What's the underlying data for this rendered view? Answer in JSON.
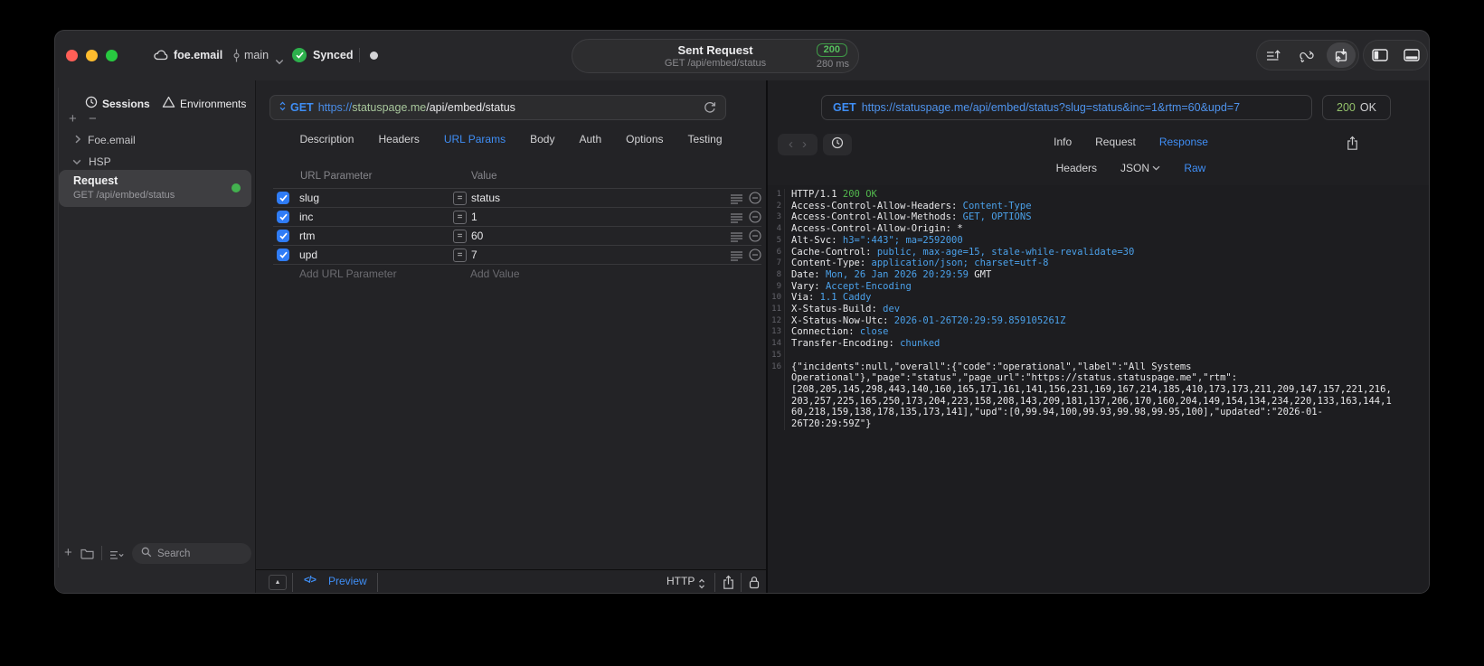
{
  "colors": {
    "accent_blue": "#3f8ef5",
    "value_blue": "#4ba1ea",
    "status_green": "#52b84d",
    "host_green": "#a8c79c",
    "checkbox_blue": "#2f7cf6",
    "traffic_red": "#ff5f57",
    "traffic_yellow": "#febc2e",
    "traffic_green": "#28c840"
  },
  "icons": {
    "titlebar": [
      "cloud-icon",
      "commit-icon",
      "chevron-down-icon",
      "synced-check-icon",
      "recording-dot"
    ],
    "toolbar": [
      "request-list-icon",
      "loop-icon",
      "send-receive-icon",
      "panel-left-icon",
      "panel-bottom-icon"
    ],
    "sidebar": [
      "clock-icon",
      "environments-triangle-icon",
      "plus-icon",
      "minus-icon",
      "chevron-right-icon",
      "chevron-down-icon",
      "folder-icon",
      "list-filter-icon",
      "search-icon"
    ],
    "request": [
      "method-updown-icon",
      "refresh-icon",
      "checkbox-check-icon",
      "equals-badge",
      "reorder-handle-icon",
      "remove-circle-icon",
      "expand-up-icon",
      "code-icon",
      "http-updown-icon",
      "share-icon",
      "lock-icon"
    ],
    "response": [
      "back-icon",
      "forward-icon",
      "history-clock-icon",
      "share-icon",
      "json-chevron-icon"
    ]
  },
  "titlebar": {
    "cloud_label": "foe.email",
    "branch": "main",
    "sync_status": "Synced",
    "sent_request": {
      "title": "Sent Request",
      "subtitle": "GET /api/embed/status",
      "status_code": "200",
      "duration": "280 ms"
    }
  },
  "sidebar": {
    "tabs": [
      {
        "label": "Sessions"
      },
      {
        "label": "Environments"
      }
    ],
    "tree": [
      {
        "label": "Foe.email",
        "state": "collapsed"
      },
      {
        "label": "HSP",
        "state": "expanded"
      }
    ],
    "request_item": {
      "title": "Request",
      "subtitle": "GET /api/embed/status"
    },
    "search_placeholder": "Search"
  },
  "request_panel": {
    "method": "GET",
    "url_scheme": "https://",
    "url_host": "statuspage.me",
    "url_path": "/api/embed/status",
    "tabs": [
      "Description",
      "Headers",
      "URL Params",
      "Body",
      "Auth",
      "Options",
      "Testing"
    ],
    "active_tab": "URL Params",
    "params_table": {
      "columns": [
        "URL Parameter",
        "Value"
      ],
      "eq_symbol": "=",
      "rows": [
        {
          "name": "slug",
          "value": "status",
          "enabled": true
        },
        {
          "name": "inc",
          "value": "1",
          "enabled": true
        },
        {
          "name": "rtm",
          "value": "60",
          "enabled": true
        },
        {
          "name": "upd",
          "value": "7",
          "enabled": true
        }
      ],
      "add_name_placeholder": "Add URL Parameter",
      "add_value_placeholder": "Add Value"
    },
    "footer": {
      "expand_glyph": "▲",
      "code_glyph": "</>",
      "preview_label": "Preview",
      "protocol_label": "HTTP"
    }
  },
  "response_panel": {
    "method": "GET",
    "url": "https://statuspage.me/api/embed/status?slug=status&inc=1&rtm=60&upd=7",
    "status": {
      "code": "200",
      "text": "OK"
    },
    "nav": {
      "back": "‹",
      "forward": "›"
    },
    "tabs": [
      "Info",
      "Request",
      "Response"
    ],
    "active_tab": "Response",
    "subtabs": [
      {
        "label": "Headers"
      },
      {
        "label": "JSON",
        "dropdown": true
      },
      {
        "label": "Raw"
      }
    ],
    "active_subtab": "Raw",
    "code_lines": [
      {
        "n": "1",
        "segs": [
          [
            "HTTP/1.1 ",
            "p"
          ],
          [
            "200 OK",
            "g"
          ]
        ]
      },
      {
        "n": "2",
        "segs": [
          [
            "Access-Control-Allow-Headers: ",
            "p"
          ],
          [
            "Content-Type",
            "b"
          ]
        ]
      },
      {
        "n": "3",
        "segs": [
          [
            "Access-Control-Allow-Methods: ",
            "p"
          ],
          [
            "GET, OPTIONS",
            "b"
          ]
        ]
      },
      {
        "n": "4",
        "segs": [
          [
            "Access-Control-Allow-Origin: *",
            "p"
          ]
        ]
      },
      {
        "n": "5",
        "segs": [
          [
            "Alt-Svc: ",
            "p"
          ],
          [
            "h3=\":443\"; ma=2592000",
            "b"
          ]
        ]
      },
      {
        "n": "6",
        "segs": [
          [
            "Cache-Control: ",
            "p"
          ],
          [
            "public, max-age=15, stale-while-revalidate=30",
            "b"
          ]
        ]
      },
      {
        "n": "7",
        "segs": [
          [
            "Content-Type: ",
            "p"
          ],
          [
            "application/json; charset=utf-8",
            "b"
          ]
        ]
      },
      {
        "n": "8",
        "segs": [
          [
            "Date: ",
            "p"
          ],
          [
            "Mon, 26 Jan 2026 20:29:59",
            "b"
          ],
          [
            " GMT",
            "p"
          ]
        ]
      },
      {
        "n": "9",
        "segs": [
          [
            "Vary: ",
            "p"
          ],
          [
            "Accept-Encoding",
            "b"
          ]
        ]
      },
      {
        "n": "10",
        "segs": [
          [
            "Via: ",
            "p"
          ],
          [
            "1.1 Caddy",
            "b"
          ]
        ]
      },
      {
        "n": "11",
        "segs": [
          [
            "X-Status-Build: ",
            "p"
          ],
          [
            "dev",
            "b"
          ]
        ]
      },
      {
        "n": "12",
        "segs": [
          [
            "X-Status-Now-Utc: ",
            "p"
          ],
          [
            "2026-01-26T20:29:59.859105261Z",
            "b"
          ]
        ]
      },
      {
        "n": "13",
        "segs": [
          [
            "Connection: ",
            "p"
          ],
          [
            "close",
            "b"
          ]
        ]
      },
      {
        "n": "14",
        "segs": [
          [
            "Transfer-Encoding: ",
            "p"
          ],
          [
            "chunked",
            "b"
          ]
        ]
      },
      {
        "n": "15",
        "segs": []
      },
      {
        "n": "16",
        "bind": "response_panel.body"
      }
    ],
    "body": "{\"incidents\":null,\"overall\":{\"code\":\"operational\",\"label\":\"All Systems Operational\"},\"page\":\"status\",\"page_url\":\"https://status.statuspage.me\",\"rtm\":[208,205,145,298,443,140,160,165,171,161,141,156,231,169,167,214,185,410,173,173,211,209,147,157,221,216,203,257,225,165,250,173,204,223,158,208,143,209,181,137,206,170,160,204,149,154,134,234,220,133,163,144,160,218,159,138,178,135,173,141],\"upd\":[0,99.94,100,99.93,99.98,99.95,100],\"updated\":\"2026-01-26T20:29:59Z\"}"
  }
}
